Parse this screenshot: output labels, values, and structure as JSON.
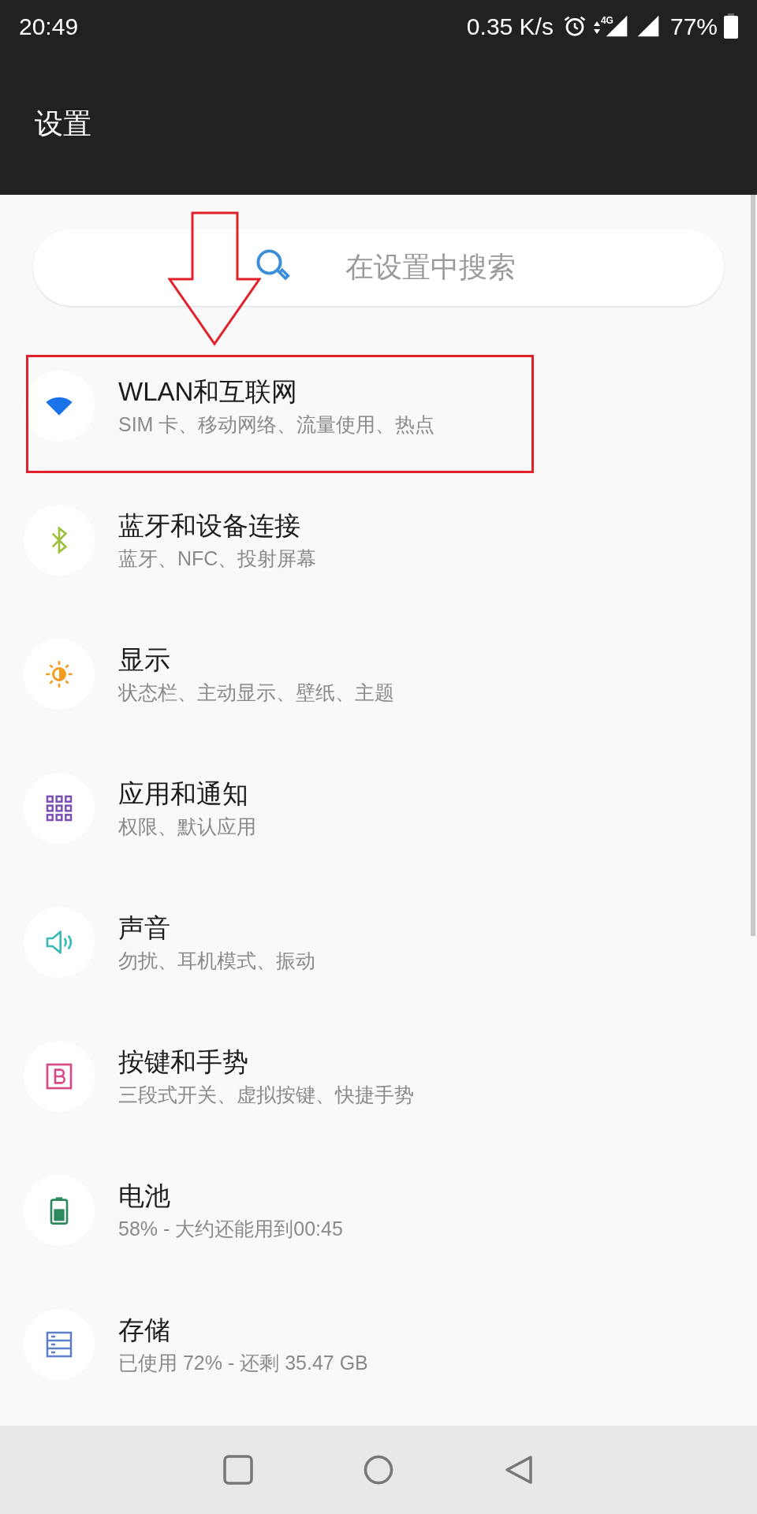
{
  "status_bar": {
    "time": "20:49",
    "net_speed": "0.35 K/s",
    "network_type": "4G",
    "battery": "77%"
  },
  "app_bar": {
    "title": "设置"
  },
  "search": {
    "placeholder": "在设置中搜索"
  },
  "items": [
    {
      "kind": "wifi",
      "title": "WLAN和互联网",
      "subtitle": "SIM 卡、移动网络、流量使用、热点",
      "highlighted": true
    },
    {
      "kind": "bluetooth",
      "title": "蓝牙和设备连接",
      "subtitle": "蓝牙、NFC、投射屏幕",
      "highlighted": false
    },
    {
      "kind": "display",
      "title": "显示",
      "subtitle": "状态栏、主动显示、壁纸、主题",
      "highlighted": false
    },
    {
      "kind": "apps",
      "title": "应用和通知",
      "subtitle": "权限、默认应用",
      "highlighted": false
    },
    {
      "kind": "sound",
      "title": "声音",
      "subtitle": "勿扰、耳机模式、振动",
      "highlighted": false
    },
    {
      "kind": "buttons",
      "title": "按键和手势",
      "subtitle": "三段式开关、虚拟按键、快捷手势",
      "highlighted": false
    },
    {
      "kind": "battery",
      "title": "电池",
      "subtitle": "58% - 大约还能用到00:45",
      "highlighted": false
    },
    {
      "kind": "storage",
      "title": "存储",
      "subtitle": "已使用 72% - 还剩 35.47 GB",
      "highlighted": false
    }
  ]
}
